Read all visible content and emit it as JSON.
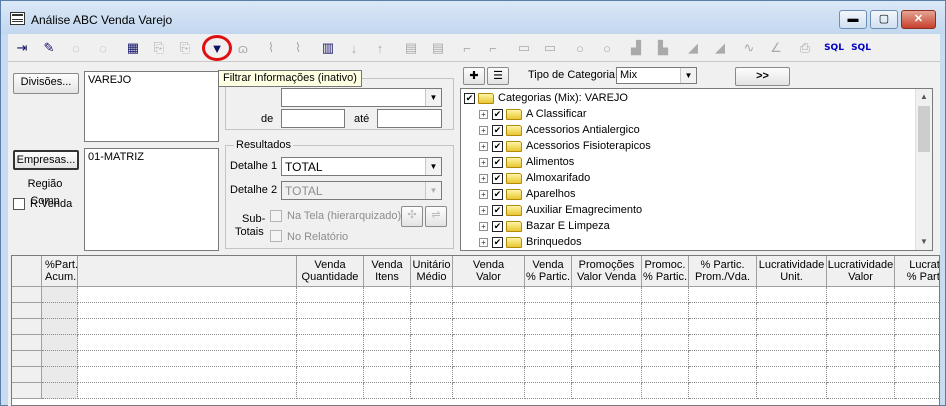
{
  "window": {
    "title": "Análise ABC Venda Varejo",
    "controls": {
      "minimize": "▬",
      "maximize": "▢",
      "close": "✕"
    }
  },
  "toolbar": {
    "tooltip": "Filtrar Informações (inativo)",
    "icons": [
      "exit-icon",
      "eraser-icon",
      "undo-icon",
      "redo-icon",
      "grid-table-icon",
      "export-icon",
      "export2-icon",
      "filter-icon",
      "binoculars-icon",
      "chart-line-icon",
      "chart-line2-icon",
      "chart-edit-icon",
      "sort-desc-icon",
      "sort-asc-icon",
      "report-icon",
      "report2-icon",
      "corner-icon",
      "corner2-icon",
      "form-icon",
      "form2-icon",
      "circle-icon",
      "circle2-icon",
      "bars-icon",
      "bars2-icon",
      "area-icon",
      "area2-icon",
      "wave-icon",
      "angle-icon",
      "export3-icon",
      "sql-icon",
      "sql2-icon"
    ],
    "sql_label": "SQL"
  },
  "left": {
    "divisoes_button": "Divisões...",
    "divisoes_value": "VAREJO",
    "empresas_button": "Empresas...",
    "empresas_value": "01-MATRIZ",
    "regiao_button": "Região Comp",
    "rvenda_label": "R.Venda"
  },
  "period": {
    "combo_value": "",
    "de_label": "de",
    "ate_label": "até",
    "de_value": "",
    "ate_value": ""
  },
  "results": {
    "group_title": "Resultados",
    "detalhe1_label": "Detalhe 1",
    "detalhe1_value": "TOTAL",
    "detalhe2_label": "Detalhe 2",
    "detalhe2_value": "TOTAL",
    "subtotais_label_1": "Sub-",
    "subtotais_label_2": "Totais",
    "na_tela_label": "Na Tela (hierarquizado)",
    "no_relatorio_label": "No Relatório"
  },
  "category": {
    "tipo_label": "Tipo de Categoria",
    "tipo_value": "Mix",
    "more_button": ">>",
    "tree_root": "Categorias (Mix): VAREJO",
    "tree_items": [
      "A Classificar",
      "Acessorios Antialergico",
      "Acessorios Fisioterapicos",
      "Alimentos",
      "Almoxarifado",
      "Aparelhos",
      "Auxiliar Emagrecimento",
      "Bazar E Limpeza",
      "Brinquedos"
    ]
  },
  "grid": {
    "columns": [
      {
        "l1": "%Part.",
        "l2": "Acum."
      },
      {
        "l1": "",
        "l2": ""
      },
      {
        "l1": "Venda",
        "l2": "Quantidade"
      },
      {
        "l1": "Venda",
        "l2": "Itens"
      },
      {
        "l1": "Unitário",
        "l2": "Médio"
      },
      {
        "l1": "Venda",
        "l2": "Valor"
      },
      {
        "l1": "Venda",
        "l2": "% Partic."
      },
      {
        "l1": "Promoções",
        "l2": "Valor Venda"
      },
      {
        "l1": "Promoc.",
        "l2": "% Partic."
      },
      {
        "l1": "% Partic.",
        "l2": "Prom./Vda."
      },
      {
        "l1": "Lucratividade",
        "l2": "Unit."
      },
      {
        "l1": "Lucratividade",
        "l2": "Valor"
      },
      {
        "l1": "Lucrat",
        "l2": "% Parti"
      }
    ],
    "row_count": 7
  }
}
